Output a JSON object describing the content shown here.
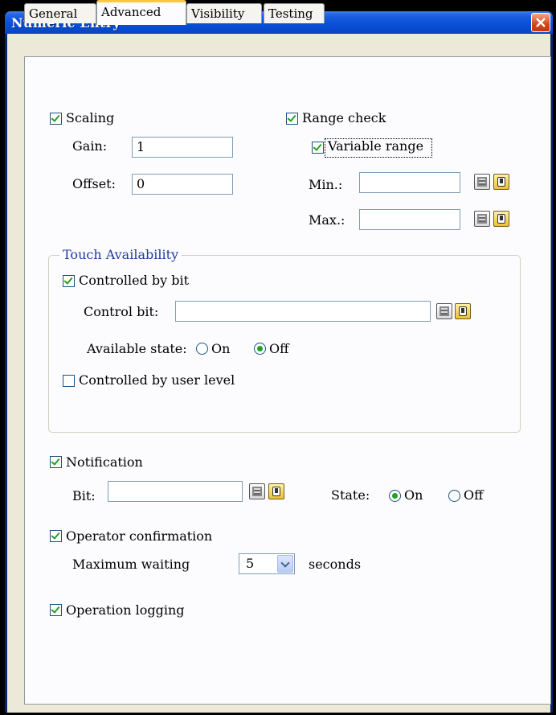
{
  "window": {
    "title": "Numeric Entry"
  },
  "tabs": [
    "General",
    "Advanced",
    "Visibility",
    "Testing"
  ],
  "active_tab": "Advanced",
  "scaling": {
    "label": "Scaling",
    "checked": true,
    "gain_label": "Gain:",
    "gain_value": "1",
    "offset_label": "Offset:",
    "offset_value": "0"
  },
  "range_check": {
    "label": "Range check",
    "checked": true,
    "variable_range_label": "Variable range",
    "variable_range_checked": true,
    "min_label": "Min.:",
    "min_value": "",
    "max_label": "Max.:",
    "max_value": ""
  },
  "touch_availability": {
    "title": "Touch Availability",
    "controlled_by_bit_label": "Controlled by bit",
    "controlled_by_bit_checked": true,
    "control_bit_label": "Control bit:",
    "control_bit_value": "",
    "available_state_label": "Available state:",
    "state_on_label": "On",
    "state_off_label": "Off",
    "selected_state": "Off",
    "controlled_by_user_level_label": "Controlled by user level",
    "controlled_by_user_level_checked": false
  },
  "notification": {
    "label": "Notification",
    "checked": true,
    "bit_label": "Bit:",
    "bit_value": "",
    "state_label": "State:",
    "on_label": "On",
    "off_label": "Off",
    "selected_state": "On"
  },
  "operator_confirmation": {
    "label": "Operator confirmation",
    "checked": true,
    "max_wait_label": "Maximum waiting",
    "max_wait_value": "5",
    "seconds_label": "seconds"
  },
  "operation_logging": {
    "label": "Operation logging",
    "checked": true
  },
  "icons": {
    "calc": "calculator-icon",
    "tag": "tag-library-icon",
    "close": "close-icon"
  }
}
